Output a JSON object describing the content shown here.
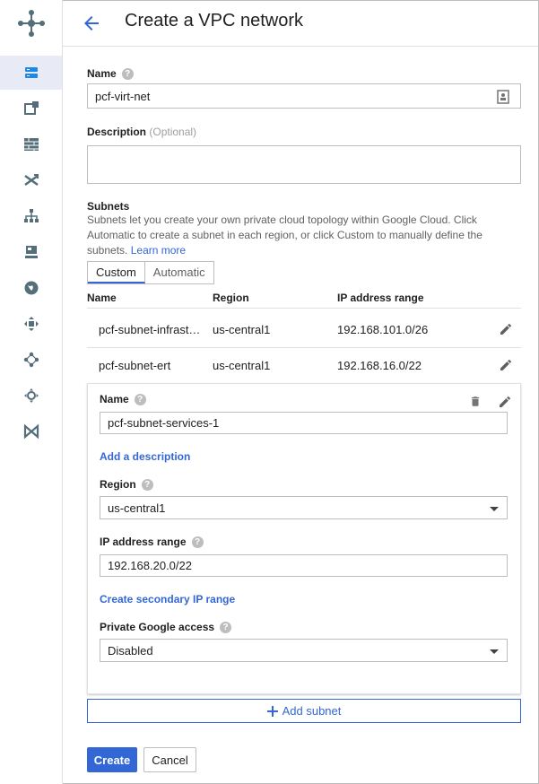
{
  "header": {
    "title": "Create a VPC network"
  },
  "sidebar": {
    "icons": [
      "vpc-network-icon",
      "external-ip-icon",
      "firewall-icon",
      "routes-icon",
      "peering-icon",
      "shared-vpc-icon",
      "serverless-access-icon",
      "packet-mirroring-icon",
      "network-topology-icon",
      "cloud-interconnect-icon",
      "connectivity-icon"
    ]
  },
  "form": {
    "name_label": "Name",
    "name_value": "pcf-virt-net",
    "description_label": "Description",
    "description_optional": "(Optional)",
    "description_value": ""
  },
  "subnets": {
    "label": "Subnets",
    "help_text": "Subnets let you create your own private cloud topology within Google Cloud. Click Automatic to create a subnet in each region, or click Custom to manually define the subnets.",
    "learn_more": "Learn more",
    "tabs": [
      "Custom",
      "Automatic"
    ],
    "columns": [
      "Name",
      "Region",
      "IP address range"
    ],
    "rows": [
      {
        "name": "pcf-subnet-infrast…",
        "region": "us-central1",
        "range": "192.168.101.0/26"
      },
      {
        "name": "pcf-subnet-ert",
        "region": "us-central1",
        "range": "192.168.16.0/22"
      }
    ]
  },
  "editor": {
    "name_label": "Name",
    "name_value": "pcf-subnet-services-1",
    "add_description": "Add a description",
    "region_label": "Region",
    "region_value": "us-central1",
    "ip_label": "IP address range",
    "ip_value": "192.168.20.0/22",
    "secondary_range": "Create secondary IP range",
    "pga_label": "Private Google access",
    "pga_value": "Disabled"
  },
  "actions": {
    "add_subnet": "Add subnet",
    "create": "Create",
    "cancel": "Cancel"
  },
  "colors": {
    "accent": "#3367d6",
    "sidebar_icon": "#546e7a",
    "active_item": "#1e88e5"
  }
}
